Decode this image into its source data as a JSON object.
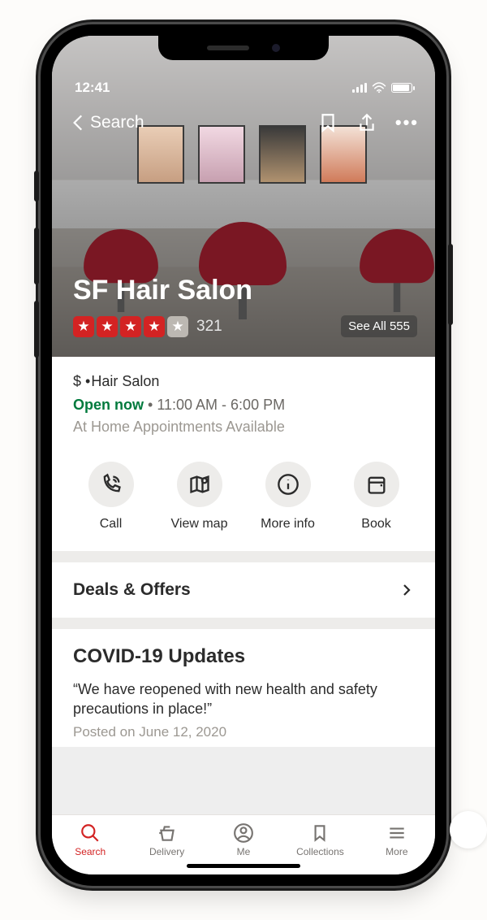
{
  "status": {
    "time": "12:41"
  },
  "header": {
    "back_label": "Search"
  },
  "business": {
    "name": "SF Hair Salon",
    "review_count": "321",
    "see_all_label": "See All 555",
    "price": "$",
    "category": "Hair Salon",
    "open_label": "Open now",
    "hours": "11:00 AM - 6:00 PM",
    "service_note": "At Home Appointments Available"
  },
  "actions": {
    "call": "Call",
    "map": "View map",
    "info": "More info",
    "book": "Book"
  },
  "deals": {
    "title": "Deals & Offers"
  },
  "covid": {
    "title": "COVID-19 Updates",
    "quote": "“We have reopened with new health and safety precautions in place!”",
    "posted": "Posted on June 12, 2020"
  },
  "tabs": {
    "search": "Search",
    "delivery": "Delivery",
    "me": "Me",
    "collections": "Collections",
    "more": "More"
  }
}
